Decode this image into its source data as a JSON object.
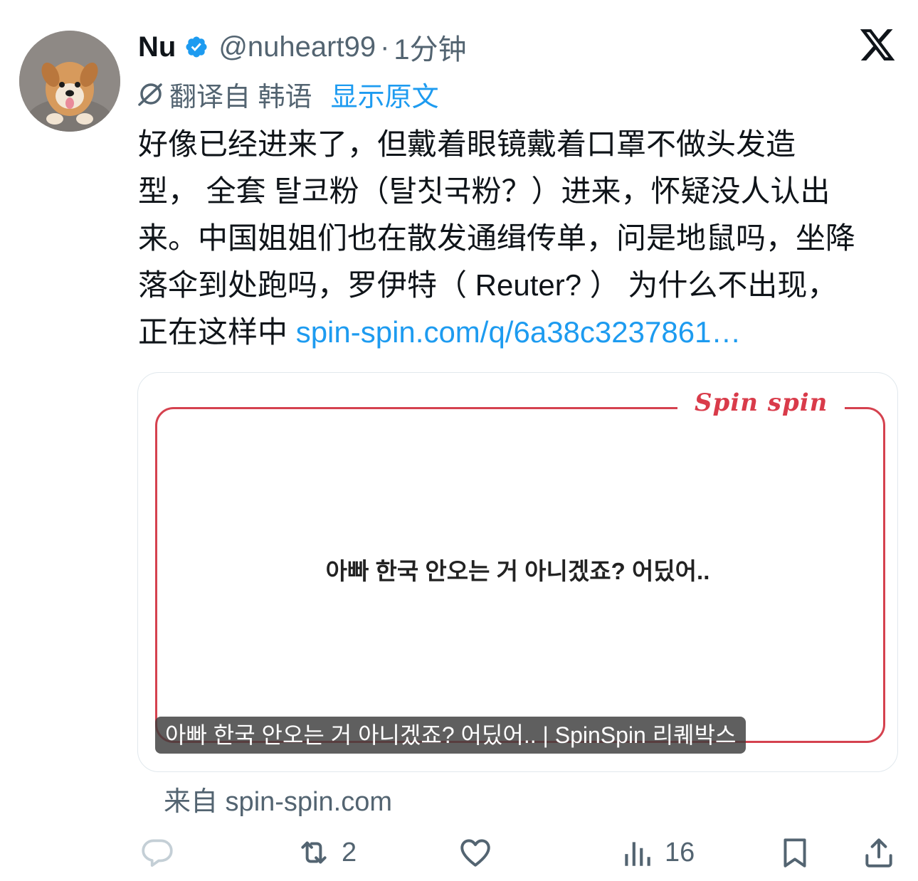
{
  "author": {
    "name": "Nu",
    "handle": "@nuheart99",
    "separator": "·",
    "time": "1分钟"
  },
  "translation": {
    "label": "翻译自 韩语",
    "show_original": "显示原文"
  },
  "tweet": {
    "text_line1": "好像已经进来了，但戴着眼镜戴着口罩不做头发造",
    "text_line2": "型，  全套 탈코粉（탈칫국粉？）进来，怀疑没人认出",
    "text_line3": "来。中国姐姐们也在散发通缉传单，问是地鼠吗，坐降",
    "text_line4": "落伞到处跑吗，罗伊特（ Reuter? ） 为什么不出现，",
    "text_line5": "正在这样中",
    "link": "spin-spin.com/q/6a38c3237861…"
  },
  "card": {
    "logo": "Spin spin",
    "question": "아빠 한국 안오는 거 아니겠죠? 어딨어..",
    "caption": "아빠 한국 안오는 거 아니겠죠? 어딨어.. | SpinSpin 리퀘박스"
  },
  "source": "来自 spin-spin.com",
  "actions": {
    "reply_icon": "comment-icon",
    "retweet_icon": "retweet-icon",
    "retweet_count": "2",
    "like_icon": "heart-icon",
    "views_icon": "views-icon",
    "views_count": "16",
    "bookmark_icon": "bookmark-icon",
    "share_icon": "share-icon"
  },
  "colors": {
    "text": "#0f1419",
    "muted": "#536471",
    "link": "#1d9bf0",
    "verified": "#1d9bf0",
    "card_accent": "#d5424f"
  }
}
